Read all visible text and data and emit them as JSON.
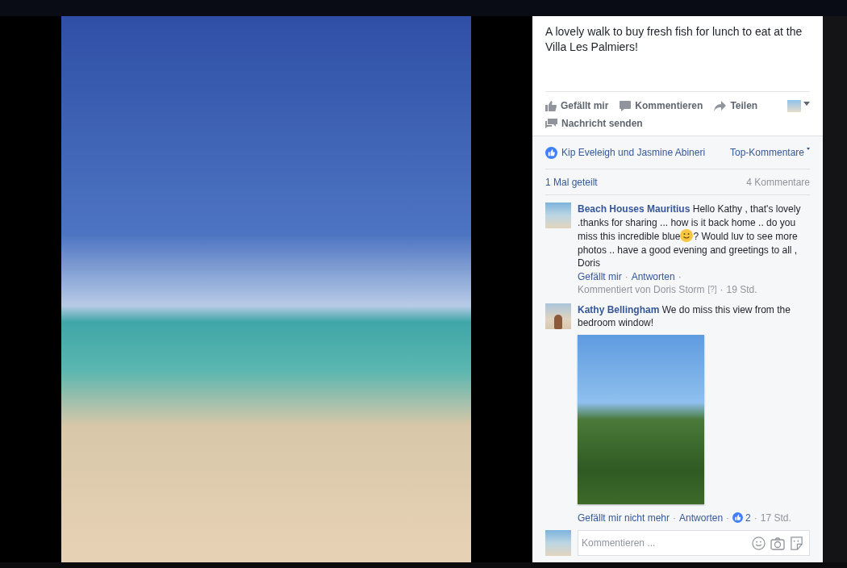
{
  "post": {
    "caption": "A lovely walk to buy fresh fish for lunch to eat at the Villa Les Palmiers!",
    "actions": [
      {
        "kind": "like",
        "label": "Gefällt mir"
      },
      {
        "kind": "comment",
        "label": "Kommentieren"
      },
      {
        "kind": "share",
        "label": "Teilen"
      },
      {
        "kind": "message",
        "label": "Nachricht senden"
      }
    ],
    "reactions": "Kip Eveleigh und Jasmine Abineri",
    "sort": "Top-Kommentare",
    "shares": "1 Mal geteilt",
    "comment_count": "4 Kommentare",
    "comments": [
      {
        "author": "Beach Houses Mauritius",
        "kind": "page",
        "text_before": "Hello Kathy , that's lovely .thanks for sharing ... how is it back home .. do you miss this incredible blue",
        "emoji": true,
        "text_after": "? Would luv to see more photos .. have a good evening and greetings to all , Doris",
        "photo": false,
        "meta": [
          {
            "kind": "link",
            "text": "Gefällt mir"
          },
          {
            "kind": "sep",
            "text": "·"
          },
          {
            "kind": "link",
            "text": "Antworten"
          },
          {
            "kind": "sep",
            "text": "·"
          },
          {
            "kind": "text",
            "text": "Kommentiert von Doris Storm"
          },
          {
            "kind": "help",
            "text": "[?]"
          },
          {
            "kind": "sep",
            "text": "·"
          },
          {
            "kind": "text",
            "text": "19 Std."
          }
        ]
      },
      {
        "author": "Kathy Bellingham",
        "kind": "person",
        "text_before": "We do miss this view from the bedroom window!",
        "emoji": false,
        "photo": true,
        "meta": [
          {
            "kind": "link",
            "text": "Gefällt mir nicht mehr"
          },
          {
            "kind": "sep",
            "text": "·"
          },
          {
            "kind": "link",
            "text": "Antworten"
          },
          {
            "kind": "sep",
            "text": "·"
          },
          {
            "kind": "likes",
            "text": "2"
          },
          {
            "kind": "sep",
            "text": "·"
          },
          {
            "kind": "text",
            "text": "17 Std."
          }
        ]
      }
    ],
    "composer": {
      "placeholder": "Kommentieren ..."
    }
  }
}
